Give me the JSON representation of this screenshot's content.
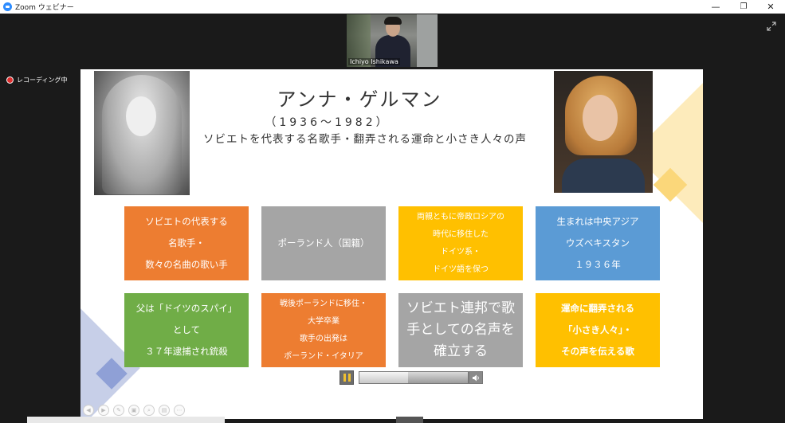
{
  "window": {
    "title": "Zoom ウェビナー",
    "controls": {
      "minimize": "—",
      "restore": "❐",
      "close": "✕"
    }
  },
  "video": {
    "participant_name": "Ichiyo Ishikawa"
  },
  "recording": {
    "label": "レコーディング中"
  },
  "slide": {
    "title": "アンナ・ゲルマン",
    "years": "（1936〜1982）",
    "subtitle": "ソビエトを代表する名歌手・翻弄される運命と小さき人々の声",
    "boxes": [
      {
        "text": "ソビエトの代表する\n名歌手・\n数々の名曲の歌い手",
        "color": "#ed7d31"
      },
      {
        "text": "ポーランド人（国籍）",
        "color": "#a5a5a5"
      },
      {
        "text": "両親ともに帝政ロシアの\n時代に移住した\nドイツ系・\nドイツ語を保つ",
        "color": "#ffc000"
      },
      {
        "text": "生まれは中央アジア\nウズベキスタン\n１９３６年",
        "color": "#5b9bd5"
      },
      {
        "text": "父は「ドイツのスパイ」\nとして\n３７年逮捕され銃殺",
        "color": "#70ad47"
      },
      {
        "text": "戦後ポーランドに移住・\n大学卒業\n歌手の出発は\nポーランド・イタリア",
        "color": "#ed7d31"
      },
      {
        "text": "ソビエト連邦で歌\n手としての名声を\n確立する",
        "color": "#a5a5a5"
      },
      {
        "text": "運命に翻弄される\n「小さき人々」・\nその声を伝える歌",
        "color": "#ffc000"
      }
    ]
  },
  "media": {
    "progress_fraction": 0.45
  },
  "icons": {
    "expand": "expand-icon",
    "pause": "pause-icon",
    "volume": "volume-icon"
  }
}
